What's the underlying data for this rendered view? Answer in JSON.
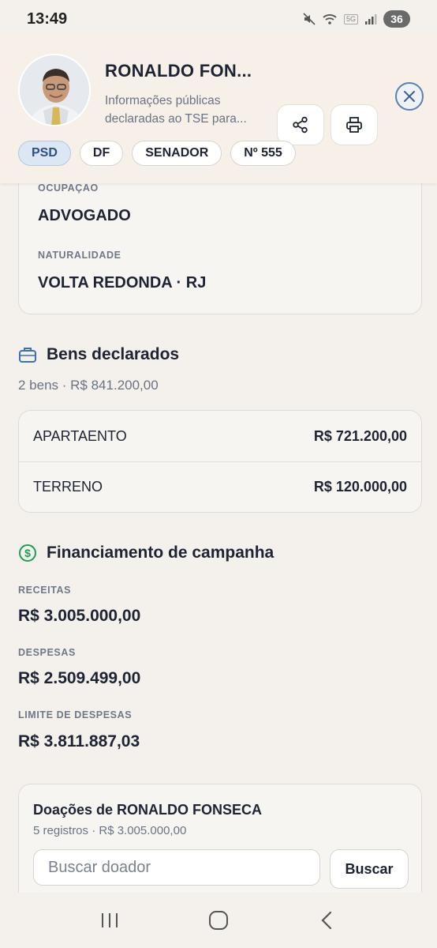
{
  "status": {
    "time": "13:49",
    "network": "5G",
    "battery": "36"
  },
  "header": {
    "name": "RONALDO FON...",
    "subtitle": "Informações públicas declaradas ao TSE para...",
    "chips": [
      "PSD",
      "DF",
      "SENADOR",
      "Nº 555"
    ]
  },
  "profile": {
    "occupation_label": "OCUPAÇÃO",
    "occupation": "ADVOGADO",
    "birthplace_label": "NATURALIDADE",
    "birthplace": "VOLTA REDONDA · RJ"
  },
  "assets": {
    "title": "Bens declarados",
    "summary": "2 bens · R$ 841.200,00",
    "items": [
      {
        "name": "APARTAENTO",
        "value": "R$ 721.200,00"
      },
      {
        "name": "TERRENO",
        "value": "R$ 120.000,00"
      }
    ]
  },
  "finance": {
    "title": "Financiamento de campanha",
    "revenue_label": "RECEITAS",
    "revenue": "R$ 3.005.000,00",
    "expenses_label": "DESPESAS",
    "expenses": "R$ 2.509.499,00",
    "limit_label": "LIMITE DE DESPESAS",
    "limit": "R$ 3.811.887,03"
  },
  "donations": {
    "title": "Doações de RONALDO FONSECA",
    "summary": "5 registros · R$ 3.005.000,00",
    "search_placeholder": "Buscar doador",
    "search_button": "Buscar"
  },
  "colors": {
    "accent": "#2d4f86",
    "green": "#1f9d55",
    "blue_icon": "#3f6fb0"
  }
}
